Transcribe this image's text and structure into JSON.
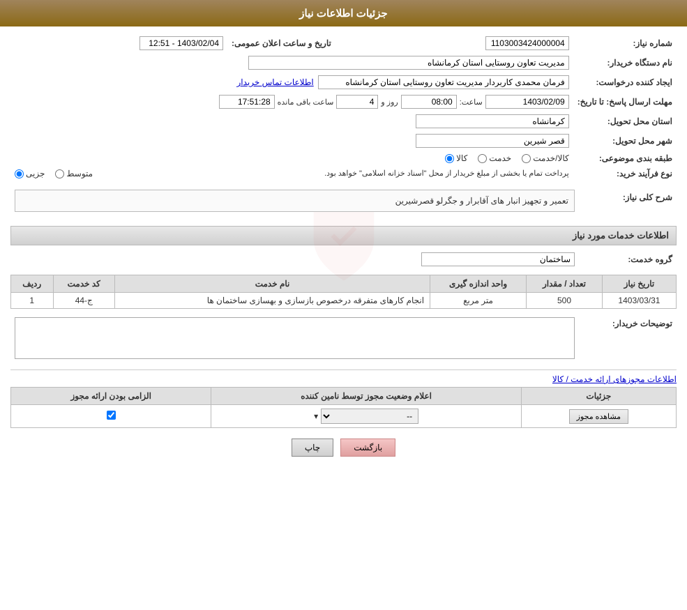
{
  "header": {
    "title": "جزئیات اطلاعات نیاز"
  },
  "fields": {
    "need_number_label": "شماره نیاز:",
    "need_number_value": "1103003424000004",
    "announce_date_label": "تاریخ و ساعت اعلان عمومی:",
    "announce_date_value": "1403/02/04 - 12:51",
    "buyer_org_label": "نام دستگاه خریدار:",
    "buyer_org_value": "مدیریت تعاون روستایی استان کرمانشاه",
    "requester_label": "ایجاد کننده درخواست:",
    "requester_value": "فرمان محمدی کاربردار مدیریت تعاون روستایی استان کرمانشاه",
    "contact_link": "اطلاعات تماس خریدار",
    "reply_deadline_label": "مهلت ارسال پاسخ: تا تاریخ:",
    "reply_date": "1403/02/09",
    "reply_time_label": "ساعت:",
    "reply_time": "08:00",
    "reply_days_label": "روز و",
    "reply_days": "4",
    "reply_remaining_label": "ساعت باقی مانده",
    "reply_remaining": "17:51:28",
    "province_label": "استان محل تحویل:",
    "province_value": "کرمانشاه",
    "city_label": "شهر محل تحویل:",
    "city_value": "قصر شیرین",
    "category_label": "طبقه بندی موضوعی:",
    "category_kala": "کالا",
    "category_khadamat": "خدمت",
    "category_kala_khadamat": "کالا/خدمت",
    "process_label": "نوع فرآیند خرید:",
    "process_jozvi": "جزیی",
    "process_motavaset": "متوسط",
    "process_note": "پرداخت تمام یا بخشی از مبلغ خریدار از محل \"اسناد خزانه اسلامی\" خواهد بود.",
    "description_section": "شرح کلی نیاز:",
    "description_value": "تعمیر و تجهیز انبار های آقابرار و جگرلو قصرشیرین",
    "services_section": "اطلاعات خدمات مورد نیاز",
    "service_group_label": "گروه خدمت:",
    "service_group_value": "ساختمان",
    "table": {
      "col_row": "ردیف",
      "col_code": "کد خدمت",
      "col_name": "نام خدمت",
      "col_unit": "واحد اندازه گیری",
      "col_quantity": "تعداد / مقدار",
      "col_date": "تاریخ نیاز",
      "rows": [
        {
          "row": "1",
          "code": "ج-44",
          "name": "انجام کارهای متفرقه درخصوص بازسازی و بهسازی ساختمان ها",
          "unit": "متر مربع",
          "quantity": "500",
          "date": "1403/03/31"
        }
      ]
    },
    "buyer_notes_label": "توضیحات خریدار:",
    "buyer_notes_value": "",
    "license_section_link": "اطلاعات مجوزهای ارائه خدمت / کالا",
    "license_table": {
      "col_required": "الزامی بودن ارائه مجوز",
      "col_status": "اعلام وضعیت مجوز توسط نامین کننده",
      "col_details": "جزئیات",
      "rows": [
        {
          "required": true,
          "status": "--",
          "details_btn": "مشاهده مجوز"
        }
      ]
    },
    "btn_print": "چاپ",
    "btn_back": "بازگشت"
  }
}
